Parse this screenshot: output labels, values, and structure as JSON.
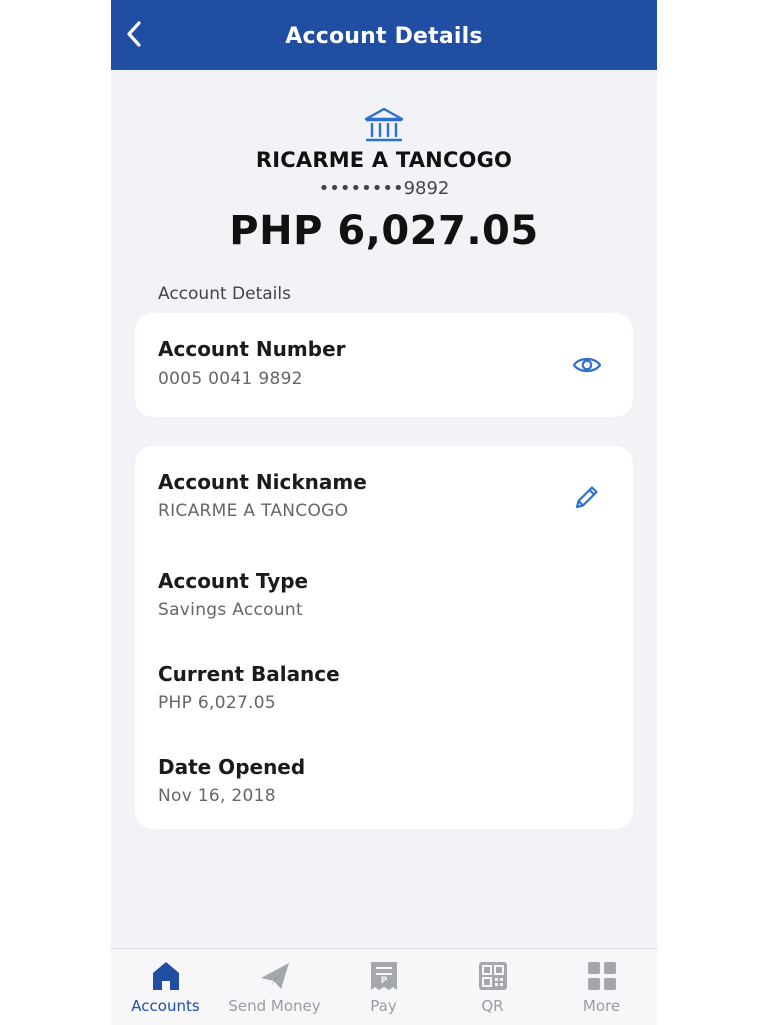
{
  "header": {
    "title": "Account Details",
    "back_icon": "chevron-left-icon"
  },
  "account": {
    "bank_icon": "bank-icon",
    "name": "RICARME A TANCOGO",
    "masked_number": "••••••••9892",
    "balance": "PHP 6,027.05"
  },
  "section_label": "Account Details",
  "account_number_card": {
    "label": "Account Number",
    "value": "0005 0041 9892",
    "action_icon": "eye-icon"
  },
  "details_card": {
    "nickname_label": "Account Nickname",
    "nickname_value": "RICARME A TANCOGO",
    "nickname_action_icon": "pencil-icon",
    "type_label": "Account Type",
    "type_value": "Savings Account",
    "balance_label": "Current Balance",
    "balance_value": "PHP 6,027.05",
    "date_label": "Date Opened",
    "date_value": "Nov 16, 2018"
  },
  "tabbar": {
    "tabs": [
      {
        "label": "Accounts",
        "icon": "home-icon",
        "active": true
      },
      {
        "label": "Send Money",
        "icon": "paper-plane-icon",
        "active": false
      },
      {
        "label": "Pay",
        "icon": "receipt-icon",
        "active": false
      },
      {
        "label": "QR",
        "icon": "qr-code-icon",
        "active": false
      },
      {
        "label": "More",
        "icon": "grid-icon",
        "active": false
      }
    ]
  },
  "colors": {
    "primary": "#1f4ea3",
    "background": "#f2f3f6",
    "card": "#ffffff",
    "inactive_tab": "#9a9ca3"
  }
}
